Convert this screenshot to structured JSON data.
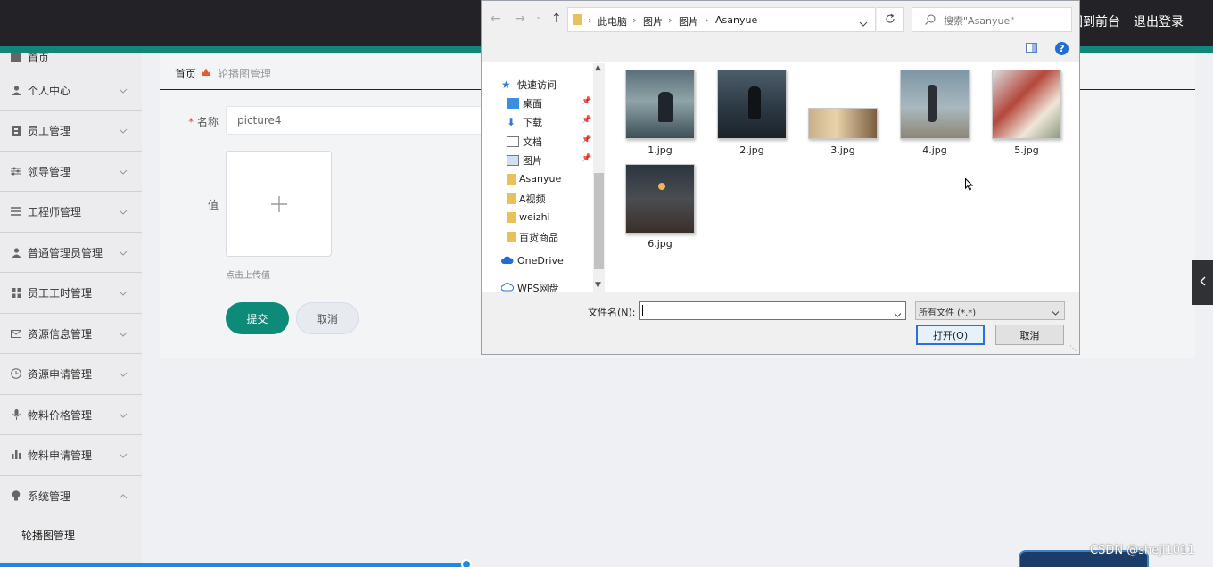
{
  "topbar": {
    "back_front": "回到前台",
    "logout": "退出登录"
  },
  "sidebar": {
    "home": "首页",
    "items": [
      {
        "label": "个人中心",
        "icon": "user-icon"
      },
      {
        "label": "员工管理",
        "icon": "badge-icon"
      },
      {
        "label": "领导管理",
        "icon": "sliders-icon"
      },
      {
        "label": "工程师管理",
        "icon": "list-icon"
      },
      {
        "label": "普通管理员管理",
        "icon": "user-icon"
      },
      {
        "label": "员工工时管理",
        "icon": "grid-icon"
      },
      {
        "label": "资源信息管理",
        "icon": "mail-icon"
      },
      {
        "label": "资源申请管理",
        "icon": "clock-icon"
      },
      {
        "label": "物料价格管理",
        "icon": "mic-icon"
      },
      {
        "label": "物料申请管理",
        "icon": "bar-chart-icon"
      },
      {
        "label": "系统管理",
        "icon": "bulb-icon"
      }
    ],
    "sub_item": "轮播图管理"
  },
  "breadcrumb": {
    "home": "首页",
    "current": "轮播图管理"
  },
  "form": {
    "name_label": "名称",
    "name_value": "picture4",
    "value_label": "值",
    "upload_tip": "点击上传值",
    "submit": "提交",
    "cancel": "取消"
  },
  "dialog": {
    "path": [
      "此电脑",
      "图片",
      "图片",
      "Asanyue"
    ],
    "search_placeholder": "搜索\"Asanyue\"",
    "nav": [
      {
        "label": "快速访问",
        "pinned": false
      },
      {
        "label": "桌面",
        "pinned": true
      },
      {
        "label": "下载",
        "pinned": true
      },
      {
        "label": "文档",
        "pinned": true
      },
      {
        "label": "图片",
        "pinned": true
      },
      {
        "label": "Asanyue",
        "pinned": false
      },
      {
        "label": "A视频",
        "pinned": false
      },
      {
        "label": "weizhi",
        "pinned": false
      },
      {
        "label": "百货商品",
        "pinned": false
      },
      {
        "label": "OneDrive",
        "pinned": false
      },
      {
        "label": "WPS网盘",
        "pinned": false
      }
    ],
    "files": [
      "1.jpg",
      "2.jpg",
      "3.jpg",
      "4.jpg",
      "5.jpg",
      "6.jpg"
    ],
    "filename_label": "文件名(N):",
    "filename_value": "",
    "filetype": "所有文件 (*.*)",
    "open": "打开(O)",
    "cancel": "取消"
  },
  "watermark": "CSDN @sheji1011",
  "colors": {
    "accent": "#0e8a79",
    "topbar": "#232327",
    "dialog_button_focus": "#2f6fd1"
  }
}
